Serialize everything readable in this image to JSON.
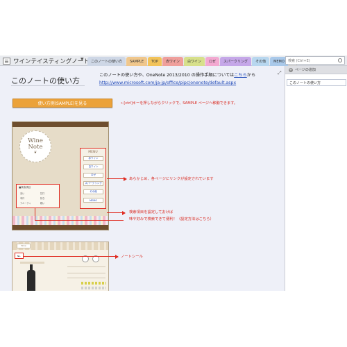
{
  "notebook": {
    "title": "ワインテイスティングノート"
  },
  "tabs": [
    {
      "label": "このノートの使い方",
      "color": "#ced7e6"
    },
    {
      "label": "SAMPLE",
      "color": "#f0c78c"
    },
    {
      "label": "TOP",
      "color": "#f2c35a"
    },
    {
      "label": "赤ワイン",
      "color": "#ef9f9c"
    },
    {
      "label": "白ワイン",
      "color": "#d7e08b"
    },
    {
      "label": "ロゼ",
      "color": "#f3a9d1"
    },
    {
      "label": "スパークリング",
      "color": "#c5a7e8"
    },
    {
      "label": "その他",
      "color": "#b8d7ef"
    },
    {
      "label": "MEMO",
      "color": "#a9c9ea"
    }
  ],
  "search": {
    "placeholder": "検索 (Ctrl+E)"
  },
  "page": {
    "title": "このノートの使い方",
    "intro_prefix": "このノートの使い方や、OneNote 2013/2010 の操作手順については",
    "intro_link": "こちら",
    "intro_suffix": "から",
    "url": "http://www.microsoft.com/ja-jp/office/pipc/onenote/default.aspx",
    "sample_button": "使い方例(SAMPLE)を見る",
    "ctrl_note": "←[ctrl]キーを押しながらクリックで、SAMPLE ページへ移動できます。",
    "menu_note": "あらかじめ、各ページにリンクが設定されています",
    "search_note_1": "検索項目を設定しておけば",
    "search_note_2": "味や好みで検索できて便利！（設定方法はこちら）",
    "seal_note": "ノートシール"
  },
  "image1": {
    "badge_line1": "Wine",
    "badge_line2": "Note",
    "menu_title": "MENU",
    "menu_items": [
      "赤ワイン",
      "白ワイン",
      "ロゼ",
      "スパークリング",
      "その他",
      "MEMO"
    ],
    "search_title": "■検索項目",
    "search_options": [
      "渋い",
      "甘口",
      "辛口",
      "好き",
      "フルーティ",
      "軽い"
    ]
  },
  "image2": {
    "badge": "Wine",
    "seal": "No."
  },
  "right_pane": {
    "add_page": "ページの追加",
    "pages": [
      "このノートの使い方"
    ]
  }
}
